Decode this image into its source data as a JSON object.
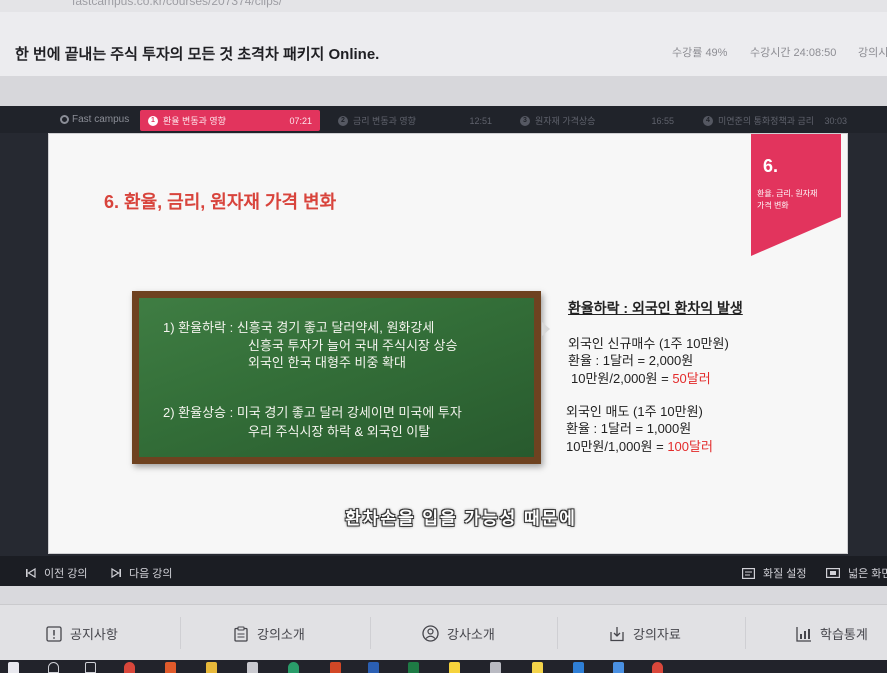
{
  "browser": {
    "url": "fastcampus.co.kr/courses/207374/clips/"
  },
  "header": {
    "course_title": "한 번에 끝내는 주식 투자의 모든 것 초격차 패키지 Online.",
    "progress_label": "수강률",
    "progress_value": "49%",
    "time_label": "수강시간",
    "time_value": "24:08:50",
    "extra_label": "강의시"
  },
  "player": {
    "logo": "Fast campus",
    "chapters": [
      {
        "number": "1",
        "title": "환율 변동과 영향",
        "time": "07:21",
        "active": true
      },
      {
        "number": "2",
        "title": "금리 변동과 영향",
        "time": "12:51",
        "active": false
      },
      {
        "number": "3",
        "title": "원자재 가격상승",
        "time": "16:55",
        "active": false
      },
      {
        "number": "4",
        "title": "미연준의 통화정책과 금리",
        "time": "30:03",
        "active": false
      }
    ],
    "slide": {
      "title": "6. 환율, 금리, 원자재 가격 변화",
      "banner": {
        "number": "6.",
        "line1": "환율, 금리, 원자재",
        "line2": "가격 변화"
      },
      "board": {
        "item1_heading": "1) 환율하락 : 신흥국 경기 좋고 달러약세, 원화강세",
        "item1_line2": "신흥국 투자가 늘어 국내 주식시장 상승",
        "item1_line3": "외국인 한국 대형주 비중 확대",
        "item2_heading": "2) 환율상승 : 미국 경기 좋고 달러 강세이면 미국에 투자",
        "item2_line2": "우리 주식시장 하락 & 외국인 이탈"
      },
      "example": {
        "heading": "환율하락 : 외국인 환차익 발생",
        "buy": {
          "title": "외국인 신규매수 (1주 10만원)",
          "rate": "환율 : 1달러 = 2,000원",
          "calc": "10만원/2,000원 = ",
          "result": "50달러"
        },
        "sell": {
          "title": "외국인 매도 (1주 10만원)",
          "rate": "환율 : 1달러 = 1,000원",
          "calc": "10만원/1,000원 = ",
          "result": "100달러"
        }
      }
    },
    "subtitle": "환차손을 입을 가능성 때문에",
    "controls": {
      "prev": "이전 강의",
      "next": "다음 강의",
      "quality": "화질 설정",
      "wide": "넓은 화면"
    }
  },
  "bottom_nav": [
    {
      "label": "공지사항",
      "icon": "notice-icon"
    },
    {
      "label": "강의소개",
      "icon": "clipboard-icon"
    },
    {
      "label": "강사소개",
      "icon": "person-icon"
    },
    {
      "label": "강의자료",
      "icon": "download-icon"
    },
    {
      "label": "학습통계",
      "icon": "stats-icon"
    }
  ],
  "taskbar": {
    "icons": [
      "windows-start-icon",
      "search-icon",
      "task-view-icon",
      "chrome-icon",
      "office-icon",
      "file-explorer-icon",
      "app-icon",
      "edge-icon",
      "powerpoint-icon",
      "word-icon",
      "excel-icon",
      "kakaotalk-icon",
      "app-icon",
      "sticky-notes-icon",
      "app-icon",
      "app-icon",
      "chrome-icon"
    ]
  },
  "colors": {
    "accent_pink": "#e2345d",
    "title_red": "#d8443c",
    "result_red": "#e32b2b",
    "board_green": "#336e38",
    "board_frame": "#6e4220"
  }
}
